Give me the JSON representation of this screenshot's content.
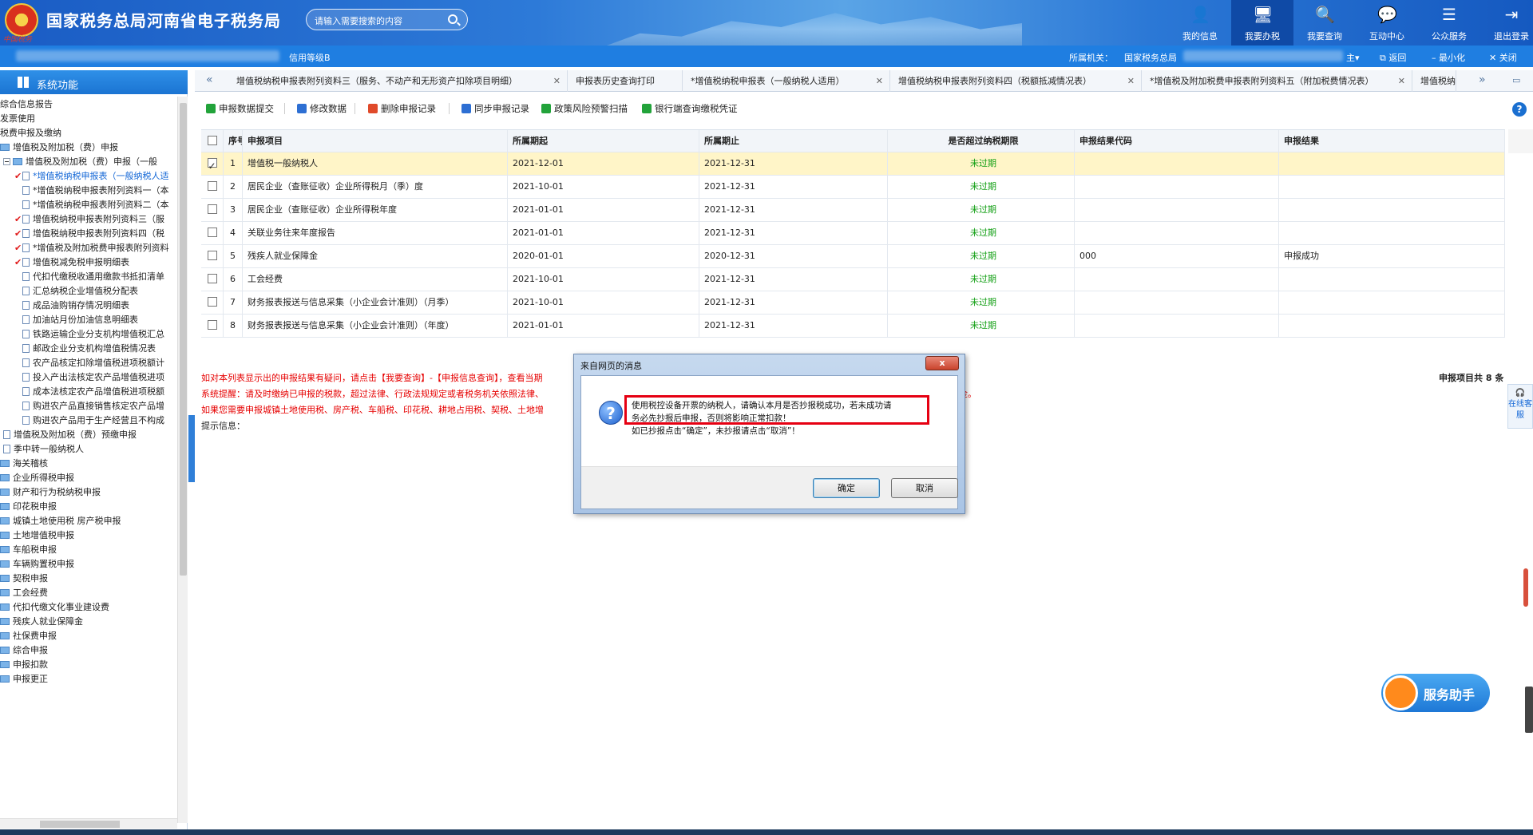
{
  "header": {
    "site_title": "国家税务总局河南省电子税务局",
    "emblem_text": "中国税务",
    "search_placeholder": "请输入需要搜索的内容",
    "nav": [
      {
        "label": "我的信息",
        "icon": "person-icon"
      },
      {
        "label": "我要办税",
        "icon": "monitor-icon"
      },
      {
        "label": "我要查询",
        "icon": "search-doc-icon"
      },
      {
        "label": "互动中心",
        "icon": "chat-icon"
      },
      {
        "label": "公众服务",
        "icon": "stack-icon"
      },
      {
        "label": "退出登录",
        "icon": "logout-icon"
      }
    ]
  },
  "infobar": {
    "credit_level": "信用等级B",
    "authority_label": "所属机关：",
    "authority_value": "国家税务总局",
    "home": "主▾",
    "back": "返回",
    "minimize": "最小化",
    "close": "关闭"
  },
  "sidebar": {
    "title": "系统功能",
    "items": [
      {
        "label": "综合信息报告",
        "type": "text"
      },
      {
        "label": "发票使用",
        "type": "text"
      },
      {
        "label": "税费申报及缴纳",
        "type": "text"
      },
      {
        "label": "增值税及附加税（费）申报",
        "type": "folder"
      },
      {
        "label": "增值税及附加税（费）申报（一般",
        "type": "folder-open"
      },
      {
        "label": "*增值税纳税申报表（一般纳税人适",
        "type": "doc",
        "checked": true,
        "selected": true
      },
      {
        "label": "*增值税纳税申报表附列资料一（本",
        "type": "doc"
      },
      {
        "label": "*增值税纳税申报表附列资料二（本",
        "type": "doc"
      },
      {
        "label": "增值税纳税申报表附列资料三（服",
        "type": "doc",
        "checked": true
      },
      {
        "label": "增值税纳税申报表附列资料四（税",
        "type": "doc",
        "checked": true
      },
      {
        "label": "*增值税及附加税费申报表附列资料",
        "type": "doc",
        "checked": true
      },
      {
        "label": "增值税减免税申报明细表",
        "type": "doc",
        "checked": true
      },
      {
        "label": "代扣代缴税收通用缴款书抵扣清单",
        "type": "doc"
      },
      {
        "label": "汇总纳税企业增值税分配表",
        "type": "doc"
      },
      {
        "label": "成品油购销存情况明细表",
        "type": "doc"
      },
      {
        "label": "加油站月份加油信息明细表",
        "type": "doc"
      },
      {
        "label": "铁路运输企业分支机构增值税汇总",
        "type": "doc"
      },
      {
        "label": "邮政企业分支机构增值税情况表",
        "type": "doc"
      },
      {
        "label": "农产品核定扣除增值税进项税额计",
        "type": "doc"
      },
      {
        "label": "投入产出法核定农产品增值税进项",
        "type": "doc"
      },
      {
        "label": "成本法核定农产品增值税进项税额",
        "type": "doc"
      },
      {
        "label": "购进农产品直接销售核定农产品增",
        "type": "doc"
      },
      {
        "label": "购进农产品用于生产经营且不构成",
        "type": "doc"
      },
      {
        "label": "增值税及附加税（费）预缴申报",
        "type": "doc-l2"
      },
      {
        "label": "季中转一般纳税人",
        "type": "doc-l2"
      },
      {
        "label": "海关稽核",
        "type": "folder"
      },
      {
        "label": "企业所得税申报",
        "type": "folder"
      },
      {
        "label": "财产和行为税纳税申报",
        "type": "folder"
      },
      {
        "label": "印花税申报",
        "type": "folder"
      },
      {
        "label": "城镇土地使用税 房产税申报",
        "type": "folder"
      },
      {
        "label": "土地增值税申报",
        "type": "folder"
      },
      {
        "label": "车船税申报",
        "type": "folder"
      },
      {
        "label": "车辆购置税申报",
        "type": "folder"
      },
      {
        "label": "契税申报",
        "type": "folder"
      },
      {
        "label": "工会经费",
        "type": "folder"
      },
      {
        "label": "代扣代缴文化事业建设费",
        "type": "folder"
      },
      {
        "label": "残疾人就业保障金",
        "type": "folder"
      },
      {
        "label": "社保费申报",
        "type": "folder"
      },
      {
        "label": "综合申报",
        "type": "folder"
      },
      {
        "label": "申报扣款",
        "type": "folder"
      },
      {
        "label": "申报更正",
        "type": "folder"
      }
    ]
  },
  "tabs": [
    "增值税纳税申报表附列资料三（服务、不动产和无形资产扣除项目明细）",
    "申报表历史查询打印",
    "*增值税纳税申报表（一般纳税人适用）",
    "增值税纳税申报表附列资料四（税额抵减情况表）",
    "*增值税及附加税费申报表附列资料五（附加税费情况表）",
    "增值税纳"
  ],
  "toolbar": [
    {
      "label": "申报数据提交",
      "icon": "check-icon",
      "color": "#22a33a"
    },
    {
      "label": "修改数据",
      "icon": "edit-icon",
      "color": "#2d6fd3"
    },
    {
      "label": "删除申报记录",
      "icon": "delete-icon",
      "color": "#e04a2a"
    },
    {
      "label": "同步申报记录",
      "icon": "sync-icon",
      "color": "#2d6fd3"
    },
    {
      "label": "政策风险预警扫描",
      "icon": "scan-icon",
      "color": "#22a33a"
    },
    {
      "label": "银行端查询缴税凭证",
      "icon": "bank-icon",
      "color": "#22a33a"
    }
  ],
  "table": {
    "headers": [
      "序号",
      "申报项目",
      "所属期起",
      "所属期止",
      "是否超过纳税期限",
      "申报结果代码",
      "申报结果"
    ],
    "rows": [
      {
        "no": "1",
        "item": "增值税一般纳税人",
        "start": "2021-12-01",
        "end": "2021-12-31",
        "overdue": "未过期",
        "code": "",
        "result": "",
        "checked": true
      },
      {
        "no": "2",
        "item": "居民企业（查账征收）企业所得税月（季）度",
        "start": "2021-10-01",
        "end": "2021-12-31",
        "overdue": "未过期",
        "code": "",
        "result": ""
      },
      {
        "no": "3",
        "item": "居民企业（查账征收）企业所得税年度",
        "start": "2021-01-01",
        "end": "2021-12-31",
        "overdue": "未过期",
        "code": "",
        "result": ""
      },
      {
        "no": "4",
        "item": "关联业务往来年度报告",
        "start": "2021-01-01",
        "end": "2021-12-31",
        "overdue": "未过期",
        "code": "",
        "result": ""
      },
      {
        "no": "5",
        "item": "残疾人就业保障金",
        "start": "2020-01-01",
        "end": "2020-12-31",
        "overdue": "未过期",
        "code": "000",
        "result": "申报成功"
      },
      {
        "no": "6",
        "item": "工会经费",
        "start": "2021-10-01",
        "end": "2021-12-31",
        "overdue": "未过期",
        "code": "",
        "result": ""
      },
      {
        "no": "7",
        "item": "财务报表报送与信息采集（小企业会计准则）（月季）",
        "start": "2021-10-01",
        "end": "2021-12-31",
        "overdue": "未过期",
        "code": "",
        "result": ""
      },
      {
        "no": "8",
        "item": "财务报表报送与信息采集（小企业会计准则）（年度）",
        "start": "2021-01-01",
        "end": "2021-12-31",
        "overdue": "未过期",
        "code": "",
        "result": ""
      }
    ],
    "count_text": "申报项目共 8 条"
  },
  "notes": {
    "line1": "如对本列表显示出的申报结果有疑问，请点击【我要查询】-【申报信息查询】，查看当期",
    "line2a": "系统提醒：请及时缴纳已申报的税款，超过法律、行政法规规定或者税务机关依照法律、",
    "line2b": "金。",
    "line3": "如果您需要申报城镇土地使用税、房产税、车船税、印花税、耕地占用税、契税、土地增",
    "tip": "提示信息："
  },
  "dialog": {
    "title": "来自网页的消息",
    "close": "x",
    "message_line1": "使用税控设备开票的纳税人，请确认本月是否抄报税成功，若未成功请",
    "message_line2": "务必先抄报后申报，否则将影响正常扣款！",
    "message_line3": "如已抄报点击“确定”，未抄报请点击“取消”！",
    "ok": "确定",
    "cancel": "取消"
  },
  "side_widgets": {
    "online_service": "在线客服",
    "helper": "服务助手"
  }
}
